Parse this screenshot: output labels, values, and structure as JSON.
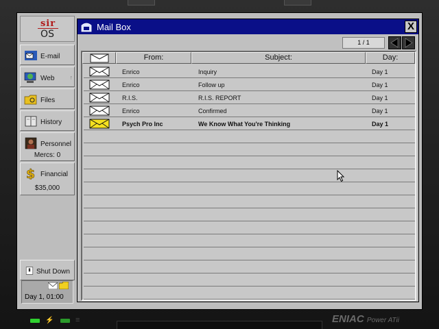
{
  "logo": {
    "top": "sir",
    "bottom": "OS"
  },
  "sidebar": {
    "email_label": "E-mail",
    "web_label": "Web",
    "files_label": "Files",
    "history_label": "History",
    "personnel_label": "Personnel",
    "personnel_sub": "Mercs: 0",
    "financial_label": "Financial",
    "financial_sub": "$35,000",
    "shutdown_label": "Shut Down",
    "status_time": "Day 1, 01:00"
  },
  "window": {
    "title": "Mail Box",
    "close_label": "X",
    "page_indicator": "1 / 1"
  },
  "columns": {
    "from": "From:",
    "subject": "Subject:",
    "day": "Day:"
  },
  "emails": [
    {
      "from": "Enrico",
      "subject": "Inquiry",
      "day": "Day 1",
      "read": true
    },
    {
      "from": "Enrico",
      "subject": "Follow up",
      "day": "Day 1",
      "read": true
    },
    {
      "from": "R.I.S.",
      "subject": "R.I.S. REPORT",
      "day": "Day 1",
      "read": true
    },
    {
      "from": "Enrico",
      "subject": "Confirmed",
      "day": "Day 1",
      "read": true
    },
    {
      "from": "Psych Pro Inc",
      "subject": "We Know What You're Thinking",
      "day": "Day 1",
      "read": false
    }
  ],
  "brand": {
    "name": "ENIAC",
    "model": "Power ATii"
  },
  "colors": {
    "titlebar": "#0a0f88",
    "unread_envelope": "#f4e020",
    "read_envelope": "#ffffff"
  }
}
